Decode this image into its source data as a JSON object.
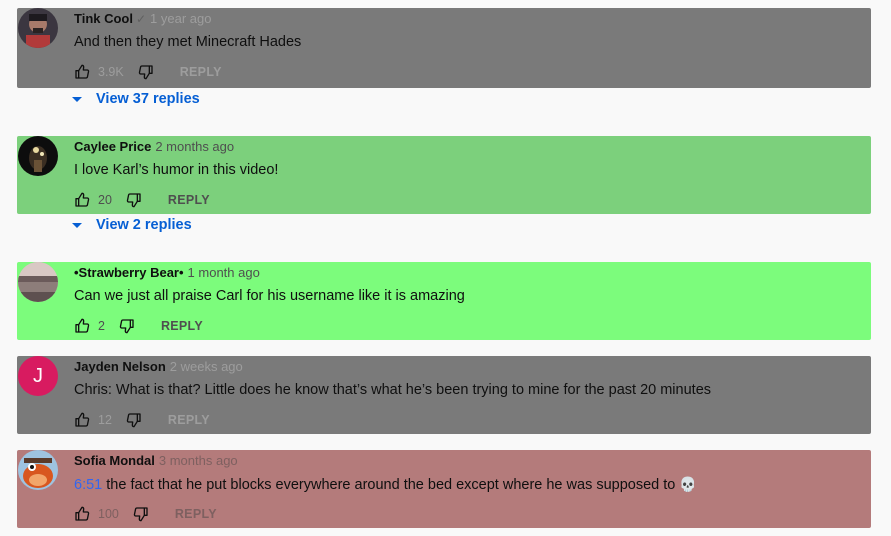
{
  "comments": [
    {
      "author": "Tink Cool",
      "verified_icon": "checkmark-icon",
      "time": "1 year ago",
      "text": "And then they met Minecraft Hades",
      "likes": "3.9K",
      "reply_label": "REPLY",
      "bg": "#7a7a7a",
      "meta_color": "#9d9d9d"
    },
    {
      "author": "Caylee Price",
      "time": "2 months ago",
      "text": "I love Karl’s humor in this video!",
      "likes": "20",
      "reply_label": "REPLY",
      "bg": "#7cd07c",
      "meta_color": "#4f4f4f"
    },
    {
      "author": "•Strawberry Bear•",
      "time": "1 month ago",
      "text": "Can we just all praise Carl for his username like it is amazing",
      "likes": "2",
      "reply_label": "REPLY",
      "bg": "#7cfc7c",
      "meta_color": "#4f4f4f"
    },
    {
      "author": "Jayden Nelson",
      "time": "2 weeks ago",
      "text": "Chris: What is that? Little does he know that’s what he’s been trying to mine for the past 20 minutes",
      "likes": "12",
      "reply_label": "REPLY",
      "bg": "#7a7a7a",
      "meta_color": "#9d9d9d",
      "avatar_letter": "J",
      "avatar_color": "#d81b60"
    },
    {
      "author": "Sofia Mondal",
      "time": "3 months ago",
      "timestamp_link": "6:51",
      "text": "the fact that he put blocks everywhere around the bed except where he was supposed to",
      "emoji": "💀",
      "likes": "100",
      "reply_label": "REPLY",
      "bg": "#b47b7b",
      "meta_color": "#7e6060"
    }
  ],
  "view_replies": [
    "View 37 replies",
    "View 2 replies"
  ],
  "icons": {
    "like": "thumbs-up-icon",
    "dislike": "thumbs-down-icon",
    "expand": "caret-down-icon"
  }
}
